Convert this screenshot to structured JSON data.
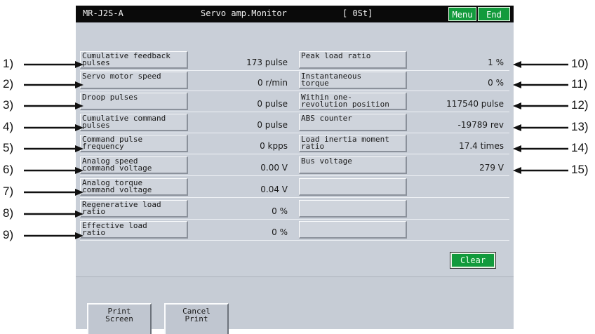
{
  "title_bar": {
    "model": "MR-J2S-A",
    "title": "Servo amp.Monitor",
    "station": "[ 0St]",
    "menu_label": "Menu",
    "end_label": "End"
  },
  "left_items": [
    {
      "label": "Cumulative feedback\npulses",
      "value": "173 pulse"
    },
    {
      "label": "Servo motor speed",
      "value": "0 r/min"
    },
    {
      "label": "Droop pulses",
      "value": "0 pulse"
    },
    {
      "label": "Cumulative command\npulses",
      "value": "0 pulse"
    },
    {
      "label": "Command pulse\nfrequency",
      "value": "0 kpps"
    },
    {
      "label": "Analog speed\ncommand voltage",
      "value": "0.00 V"
    },
    {
      "label": "Analog torque\ncommand voltage",
      "value": "0.04 V"
    },
    {
      "label": "Regenerative load\nratio",
      "value": "0 %"
    },
    {
      "label": "Effective load\nratio",
      "value": "0 %"
    }
  ],
  "right_items": [
    {
      "label": "Peak load ratio",
      "value": "1 %"
    },
    {
      "label": "Instantaneous\ntorque",
      "value": "0 %"
    },
    {
      "label": "Within one-\nrevolution position",
      "value": "117540 pulse"
    },
    {
      "label": "ABS counter",
      "value": "-19789 rev"
    },
    {
      "label": "Load inertia moment\nratio",
      "value": "17.4 times"
    },
    {
      "label": "Bus voltage",
      "value": "279 V"
    },
    {
      "label": "",
      "value": ""
    },
    {
      "label": "",
      "value": ""
    },
    {
      "label": "",
      "value": ""
    }
  ],
  "clear_label": "Clear",
  "print_screen_label": "Print\nScreen",
  "cancel_print_label": "Cancel\nPrint",
  "callouts": [
    "1)",
    "2)",
    "3)",
    "4)",
    "5)",
    "6)",
    "7)",
    "8)",
    "9)",
    "10)",
    "11)",
    "12)",
    "13)",
    "14)",
    "15)"
  ]
}
